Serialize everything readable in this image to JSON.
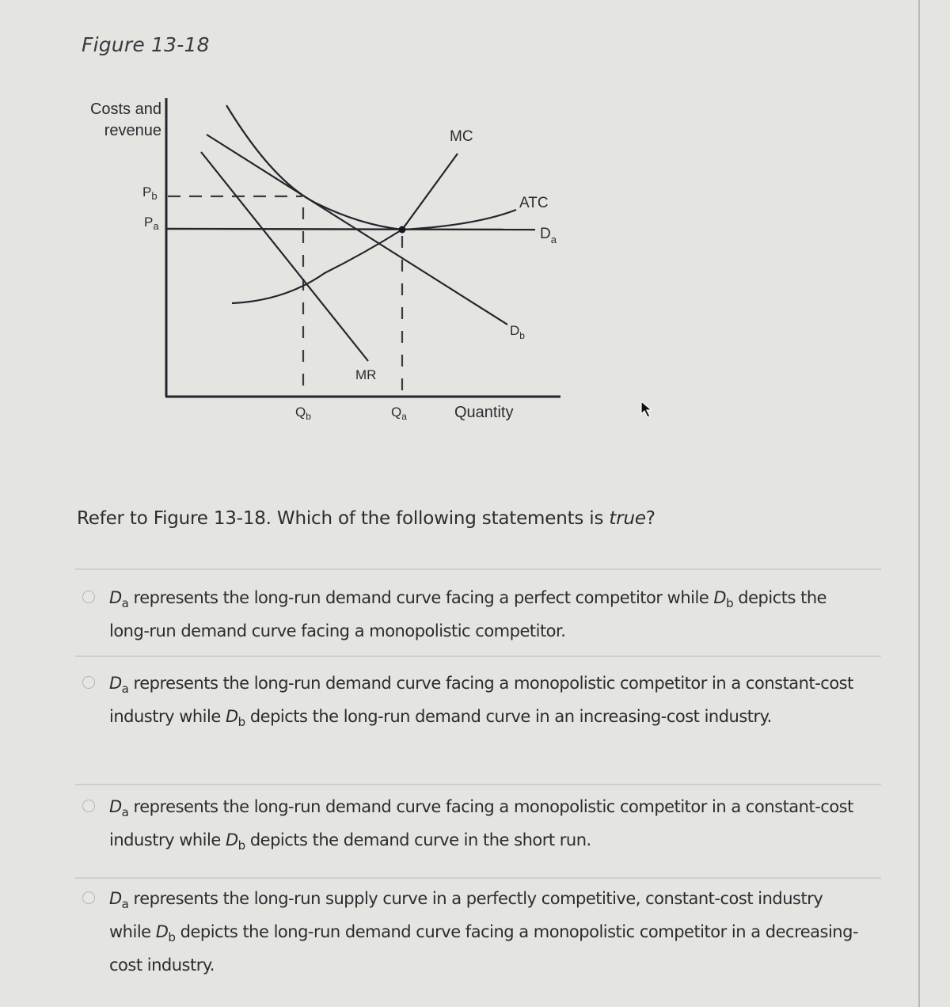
{
  "figure": {
    "title": "Figure 13-18",
    "y_axis_label_line1": "Costs and",
    "y_axis_label_line2": "revenue",
    "x_axis_label": "Quantity",
    "price_labels": {
      "pb": "P",
      "pb_sub": "b",
      "pa": "P",
      "pa_sub": "a"
    },
    "quantity_labels": {
      "qb": "Q",
      "qb_sub": "b",
      "qa": "Q",
      "qa_sub": "a"
    },
    "curve_labels": {
      "mc": "MC",
      "atc": "ATC",
      "da": "D",
      "da_sub": "a",
      "db": "D",
      "db_sub": "b",
      "mr": "MR"
    }
  },
  "question": {
    "prefix": "Refer to Figure 13-18. Which of the following statements is ",
    "emphasis": "true",
    "suffix": "?"
  },
  "options": [
    {
      "selected": false,
      "parts": [
        "D",
        "a",
        " represents the long-run demand curve facing a perfect competitor while ",
        "D",
        "b",
        " depicts the long-run demand curve facing a monopolistic competitor."
      ]
    },
    {
      "selected": false,
      "parts": [
        "D",
        "a",
        " represents the long-run demand curve facing a monopolistic competitor in a constant-cost industry while ",
        "D",
        "b",
        " depicts the long-run demand curve in an increasing-cost industry."
      ]
    },
    {
      "selected": false,
      "parts": [
        "D",
        "a",
        " represents the long-run demand curve facing a monopolistic competitor in a constant-cost industry while ",
        "D",
        "b",
        " depicts the demand curve in the short run."
      ]
    },
    {
      "selected": false,
      "parts": [
        "D",
        "a",
        " represents the long-run supply curve in a perfectly competitive, constant-cost industry while ",
        "D",
        "b",
        " depicts the long-run demand curve facing a monopolistic competitor in a decreasing-cost industry."
      ]
    }
  ]
}
